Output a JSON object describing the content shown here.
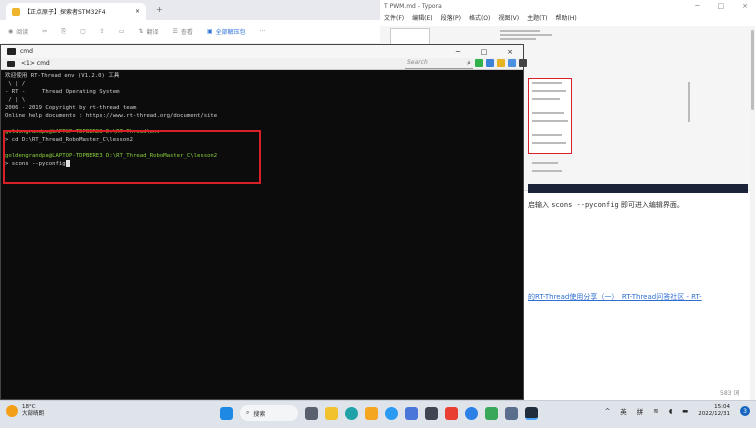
{
  "browser": {
    "tab_title": "【正点原子】探索者STM32F4",
    "tab_close": "×",
    "new_tab": "+",
    "toolbar": {
      "read": "阅读",
      "translate": "翻译",
      "view": "查看",
      "extract": "全部解压包",
      "more": "···"
    }
  },
  "typora": {
    "window_title": "T PWM.md - Typora",
    "menu": [
      "文件(F)",
      "编辑(E)",
      "段落(P)",
      "格式(O)",
      "视图(V)",
      "主题(T)",
      "帮助(H)"
    ],
    "minimize": "─",
    "maximize": "□",
    "close": "×",
    "text_before": "启输入 ",
    "code_text": "scons --pyconfig",
    "text_after": " 即可进入编辑界面。",
    "link_text": "的RT-Thread使用分享（一）_RT-Thread问答社区 - RT-",
    "word_count": "583 词"
  },
  "cmd": {
    "window_title": "cmd",
    "tab_label": "<1> cmd",
    "search_placeholder": "Search",
    "minimize": "─",
    "maximize": "□",
    "close": "×",
    "lines": [
      "欢迎使用 RT-Thread env (V1.2.0) 工具",
      " \\ | /",
      "- RT -     Thread Operating System",
      " / | \\",
      "2006 - 2019 Copyright by rt-thread team",
      "Online help documents : https://www.rt-thread.org/document/site",
      "",
      "goldengrandpa@LAPTOP-TDPBERE3 D:\\RT-Thread\\env",
      "> cd D:\\RT_Thread_RoboMaster_C\\lesson2",
      "",
      "goldengrandpa@LAPTOP-TDPBERE3 D:\\RT_Thread_RoboMaster_C\\lesson2",
      "> scons --pyconfig"
    ]
  },
  "taskbar": {
    "weather_temp": "18°C",
    "weather_desc": "大部晴朗",
    "search_label": "搜索",
    "tray_chevron": "^",
    "ime_1": "英",
    "ime_2": "拼",
    "time": "15:04",
    "date": "2022/12/31",
    "notification_count": "3"
  },
  "colors": {
    "terminal_bg": "#0c0c0c",
    "terminal_text": "#cfcfcf",
    "prompt_green": "#8bd13c",
    "highlight_red": "#d92029",
    "link_blue": "#2f6fd1"
  }
}
